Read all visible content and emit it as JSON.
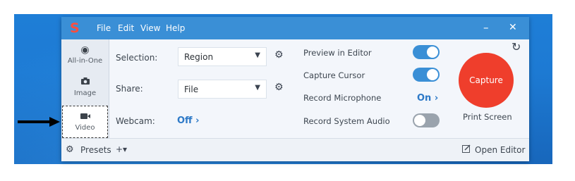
{
  "titlebar": {
    "logo": "S",
    "menu": [
      "File",
      "Edit",
      "View",
      "Help"
    ],
    "minimize": "–",
    "close": "✕"
  },
  "sidebar": {
    "modes": [
      {
        "label": "All-in-One",
        "icon": "circle-icon"
      },
      {
        "label": "Image",
        "icon": "camera-icon"
      },
      {
        "label": "Video",
        "icon": "video-camera-icon",
        "active": true
      }
    ]
  },
  "settings": {
    "selection_label": "Selection:",
    "selection_value": "Region",
    "share_label": "Share:",
    "share_value": "File",
    "webcam_label": "Webcam:",
    "webcam_value": "Off",
    "webcam_chevron": "›"
  },
  "options": {
    "preview_label": "Preview in Editor",
    "preview_on": true,
    "cursor_label": "Capture Cursor",
    "cursor_on": true,
    "microphone_label": "Record Microphone",
    "microphone_value": "On",
    "microphone_chevron": "›",
    "system_audio_label": "Record System Audio",
    "system_audio_on": false
  },
  "capture": {
    "button_label": "Capture",
    "shortcut": "Print Screen",
    "reset_icon": "↻"
  },
  "bottombar": {
    "presets_label": "Presets",
    "add_label": "+▾",
    "open_editor_label": "Open Editor"
  },
  "colors": {
    "titlebar": "#3a8fd6",
    "capture": "#ef3e2c",
    "accent": "#2d79c7",
    "desktop": "#1d7ad3"
  }
}
